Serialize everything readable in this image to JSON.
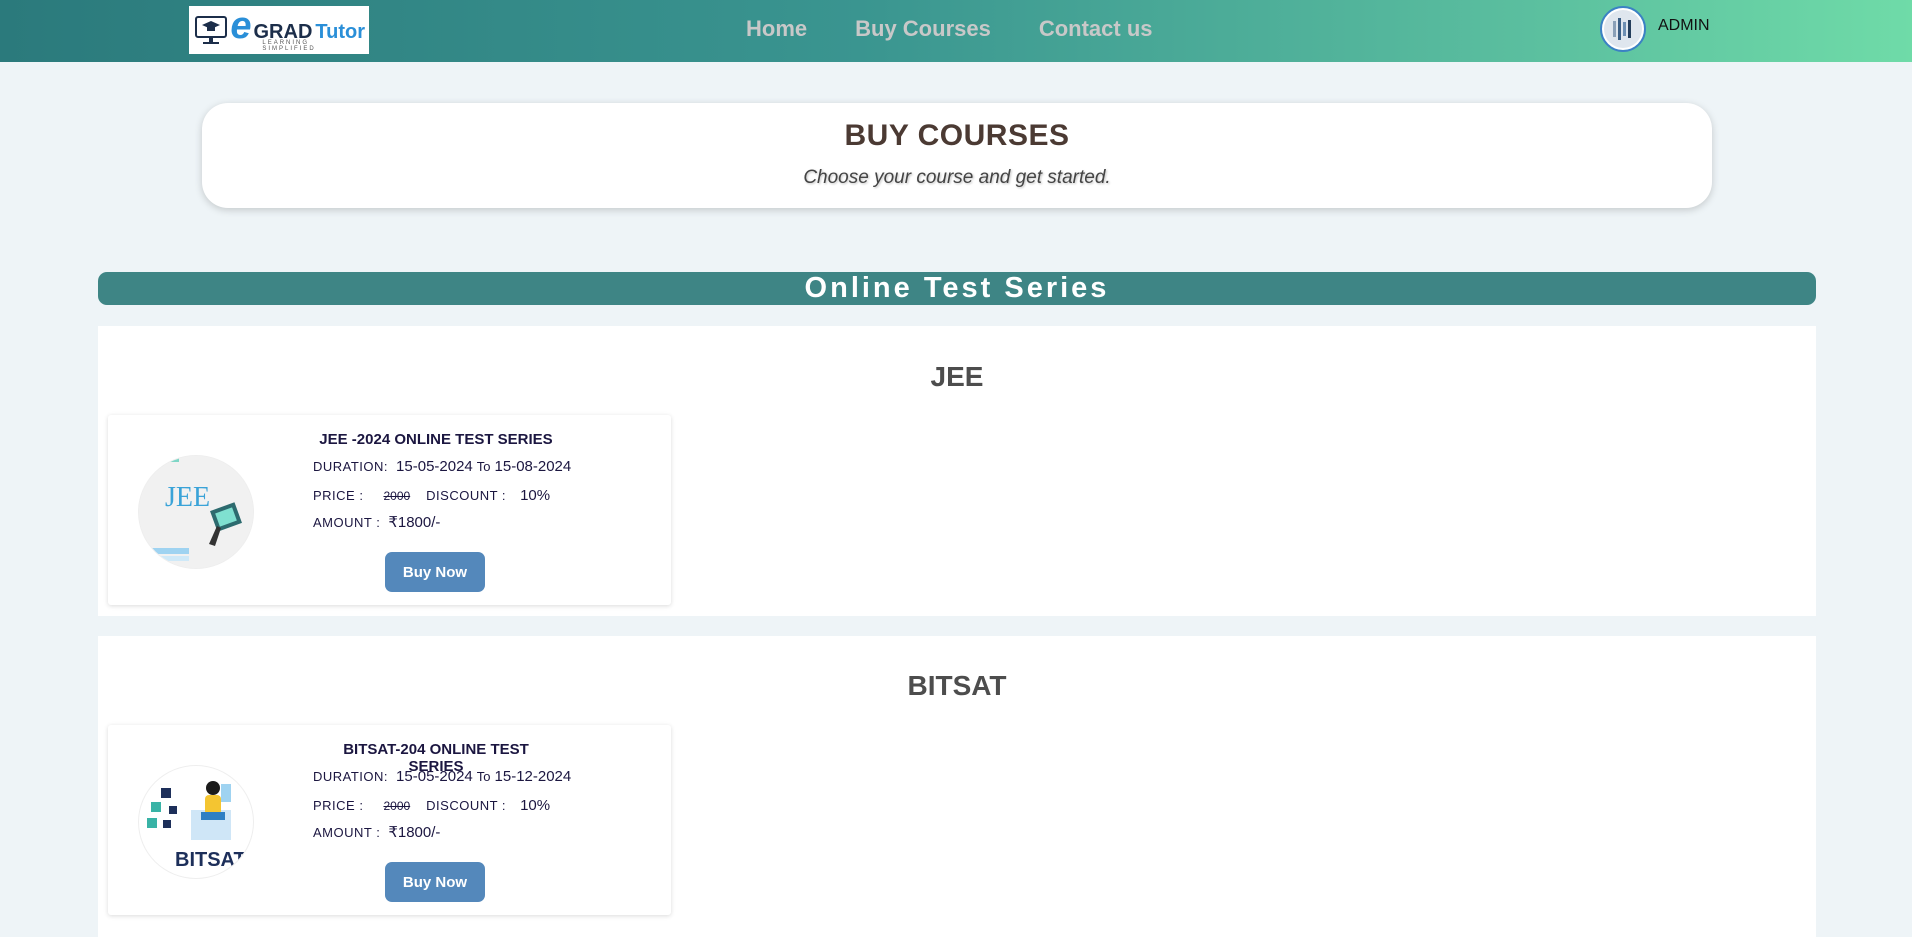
{
  "header": {
    "logo": {
      "e": "e",
      "grad": "GRAD",
      "tutor": "Tutor",
      "tagline": "LEARNING SIMPLIFIED"
    },
    "nav": [
      {
        "label": "Home"
      },
      {
        "label": "Buy Courses"
      },
      {
        "label": "Contact us"
      }
    ],
    "user_label": "ADMIN"
  },
  "hero": {
    "title": "BUY COURSES",
    "subtitle": "Choose your course and get started."
  },
  "section_title": "Online Test Series",
  "categories": [
    {
      "name": "JEE",
      "course": {
        "title": "JEE -2024 ONLINE TEST SERIES",
        "duration_label": "DURATION:",
        "start": "15-05-2024",
        "to": "To",
        "end": "15-08-2024",
        "price_label": "PRICE :",
        "price": "2000",
        "discount_label": "DISCOUNT :",
        "discount": "10%",
        "amount_label": "AMOUNT :",
        "amount": "₹1800/-",
        "button": "Buy Now",
        "thumb_text": "JEE"
      }
    },
    {
      "name": "BITSAT",
      "course": {
        "title": "BITSAT-204 ONLINE TEST SERIES",
        "duration_label": "DURATION:",
        "start": "15-05-2024",
        "to": "To",
        "end": "15-12-2024",
        "price_label": "PRICE :",
        "price": "2000",
        "discount_label": "DISCOUNT :",
        "discount": "10%",
        "amount_label": "AMOUNT :",
        "amount": "₹1800/-",
        "button": "Buy Now",
        "thumb_text": "BITSAT"
      }
    }
  ],
  "colors": {
    "header_start": "#2b7a7c",
    "header_end": "#6fdba8",
    "banner": "#3e8585",
    "button": "#5488bb"
  }
}
